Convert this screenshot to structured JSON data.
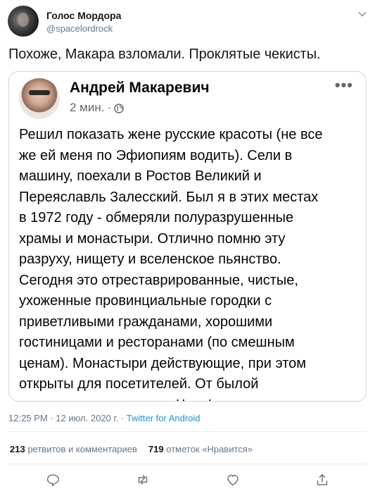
{
  "header": {
    "name": "Голос Мордора",
    "handle": "@spacelordrock"
  },
  "tweet": {
    "text": "Похоже, Макара взломали. Проклятые чекисты."
  },
  "embedded_post": {
    "author": "Андрей Макаревич",
    "time": "2 мин.",
    "dot": "·",
    "more": "•••",
    "body_lines": [
      "Решил показать жене русские красоты (не все",
      "же ей меня по Эфиопиям водить). Сели в",
      "машину, поехали в Ростов Великий и",
      "Переяславль Залесский. Был я в этих местах",
      "в 1972 году - обмеряли полуразрушенные",
      "храмы и монастыри. Отлично помню эту",
      "разруху, нищету и вселенское пьянство.",
      "Сегодня это отреставрированные, чистые,",
      "ухоженные провинциальные городки с",
      "приветливыми гражданами, хорошими",
      "гостиницами и ресторанами (по смешным",
      "ценам). Монастыри действующие, при этом",
      "открыты для посетителей. От былой",
      "депрессии нет и следа. Чудо!"
    ]
  },
  "meta": {
    "time": "12:25 PM",
    "date": "12 июл. 2020 г.",
    "separator": "·",
    "source": "Twitter for Android"
  },
  "stats": {
    "retweets_count": "213",
    "retweets_label": "ретвитов и комментариев",
    "likes_count": "719",
    "likes_label": "отметок «Нравится»"
  },
  "icons": {
    "caret": "chevron-down-icon",
    "reply": "reply-icon",
    "retweet": "retweet-icon",
    "like": "heart-icon",
    "share": "share-icon"
  },
  "colors": {
    "text": "#14171a",
    "secondary": "#657786",
    "link": "#1b95e0",
    "border": "#ccd6dd"
  }
}
